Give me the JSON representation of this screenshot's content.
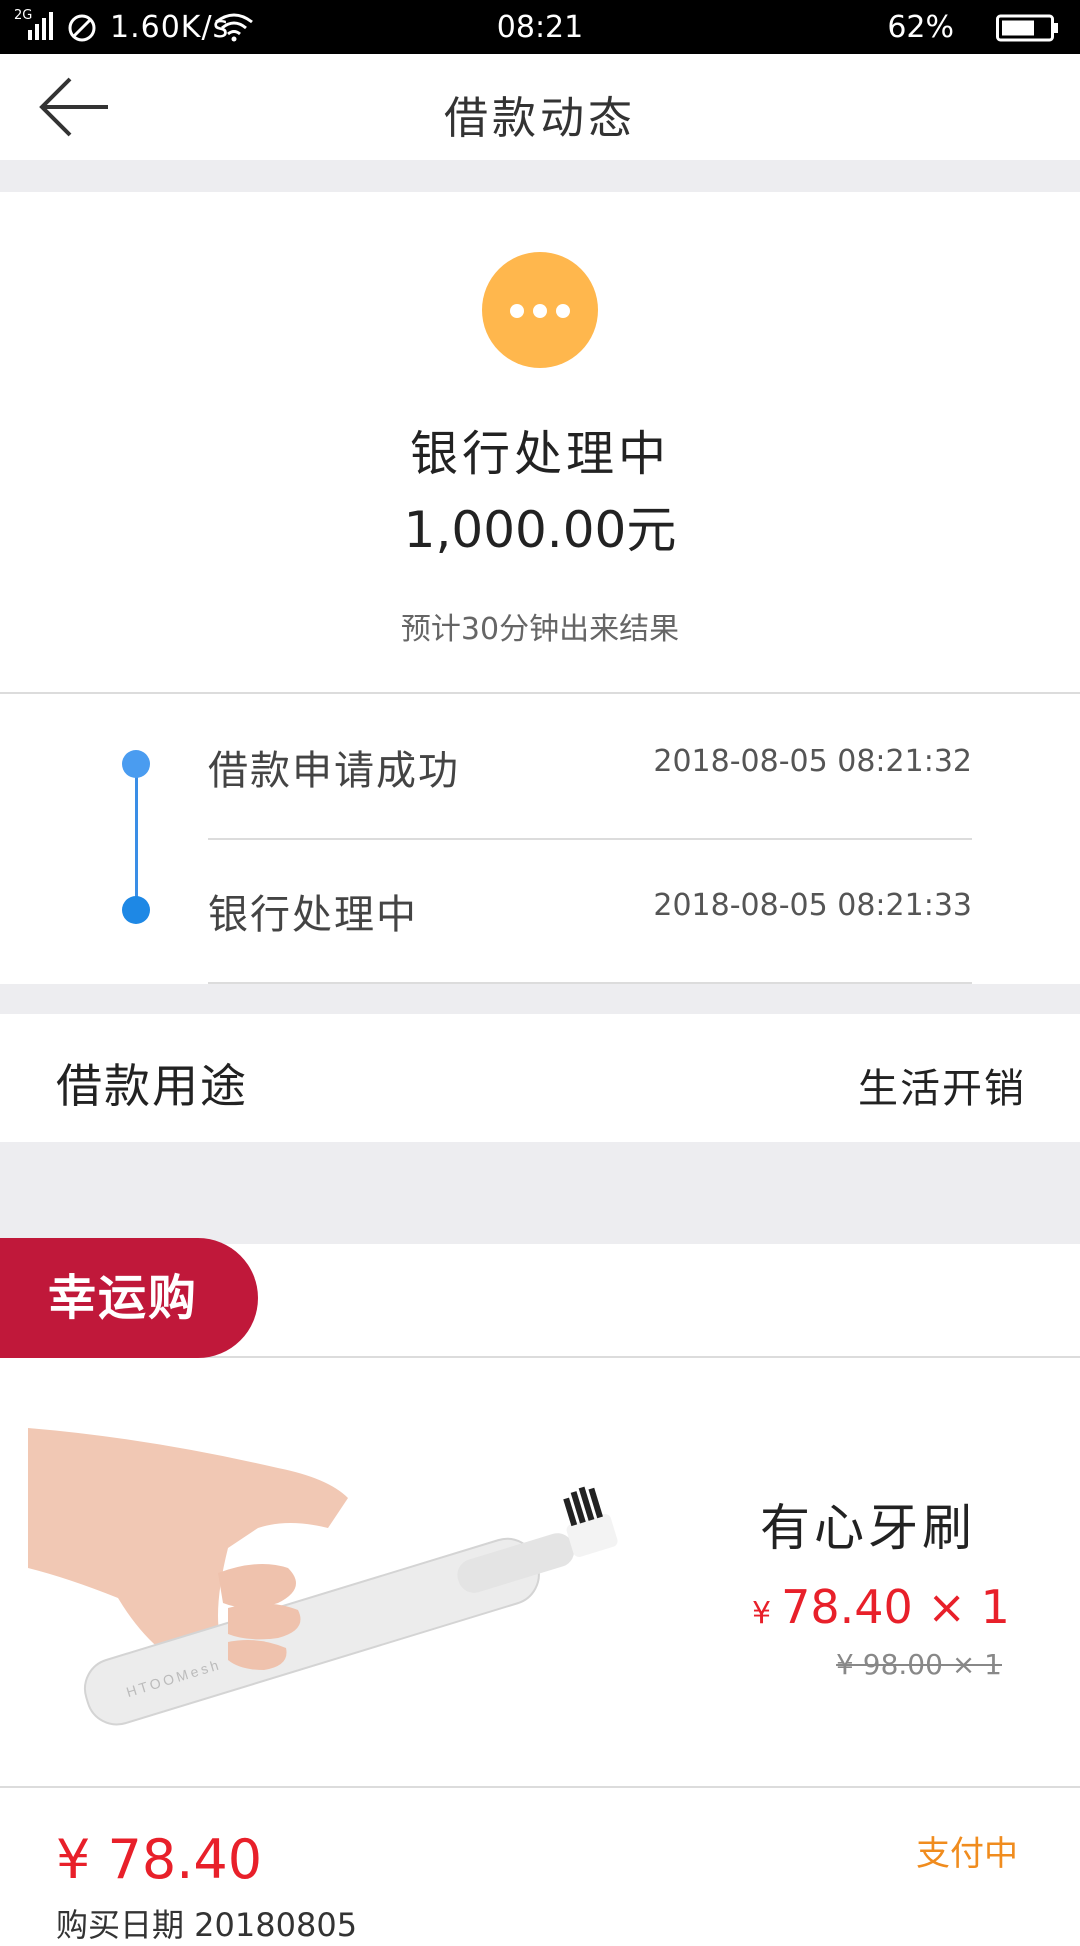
{
  "status_bar": {
    "network": "2G",
    "speed": "1.60K/s",
    "time": "08:21",
    "battery": "62%"
  },
  "nav": {
    "title": "借款动态"
  },
  "loan_status": {
    "title": "银行处理中",
    "amount": "1,000.00元",
    "eta": "预计30分钟出来结果",
    "icon_color": "#ffb74d"
  },
  "timeline": [
    {
      "label": "借款申请成功",
      "time": "2018-08-05 08:21:32"
    },
    {
      "label": "银行处理中",
      "time": "2018-08-05 08:21:33"
    }
  ],
  "purpose": {
    "label": "借款用途",
    "value": "生活开销"
  },
  "lucky_shop": {
    "badge": "幸运购",
    "badge_color": "#c0183a"
  },
  "product": {
    "name": "有心牙刷",
    "currency": "¥",
    "price": "78.40",
    "qty": "× 1",
    "original": "¥ 98.00 × 1",
    "image_icon": "toothbrush-in-hand-image"
  },
  "order": {
    "total": "¥ 78.40",
    "status": "支付中",
    "sub": "购买日期 20180805"
  },
  "colors": {
    "accent_blue": "#1e88e5",
    "price_red": "#e8202a",
    "status_orange": "#f08c1e"
  }
}
